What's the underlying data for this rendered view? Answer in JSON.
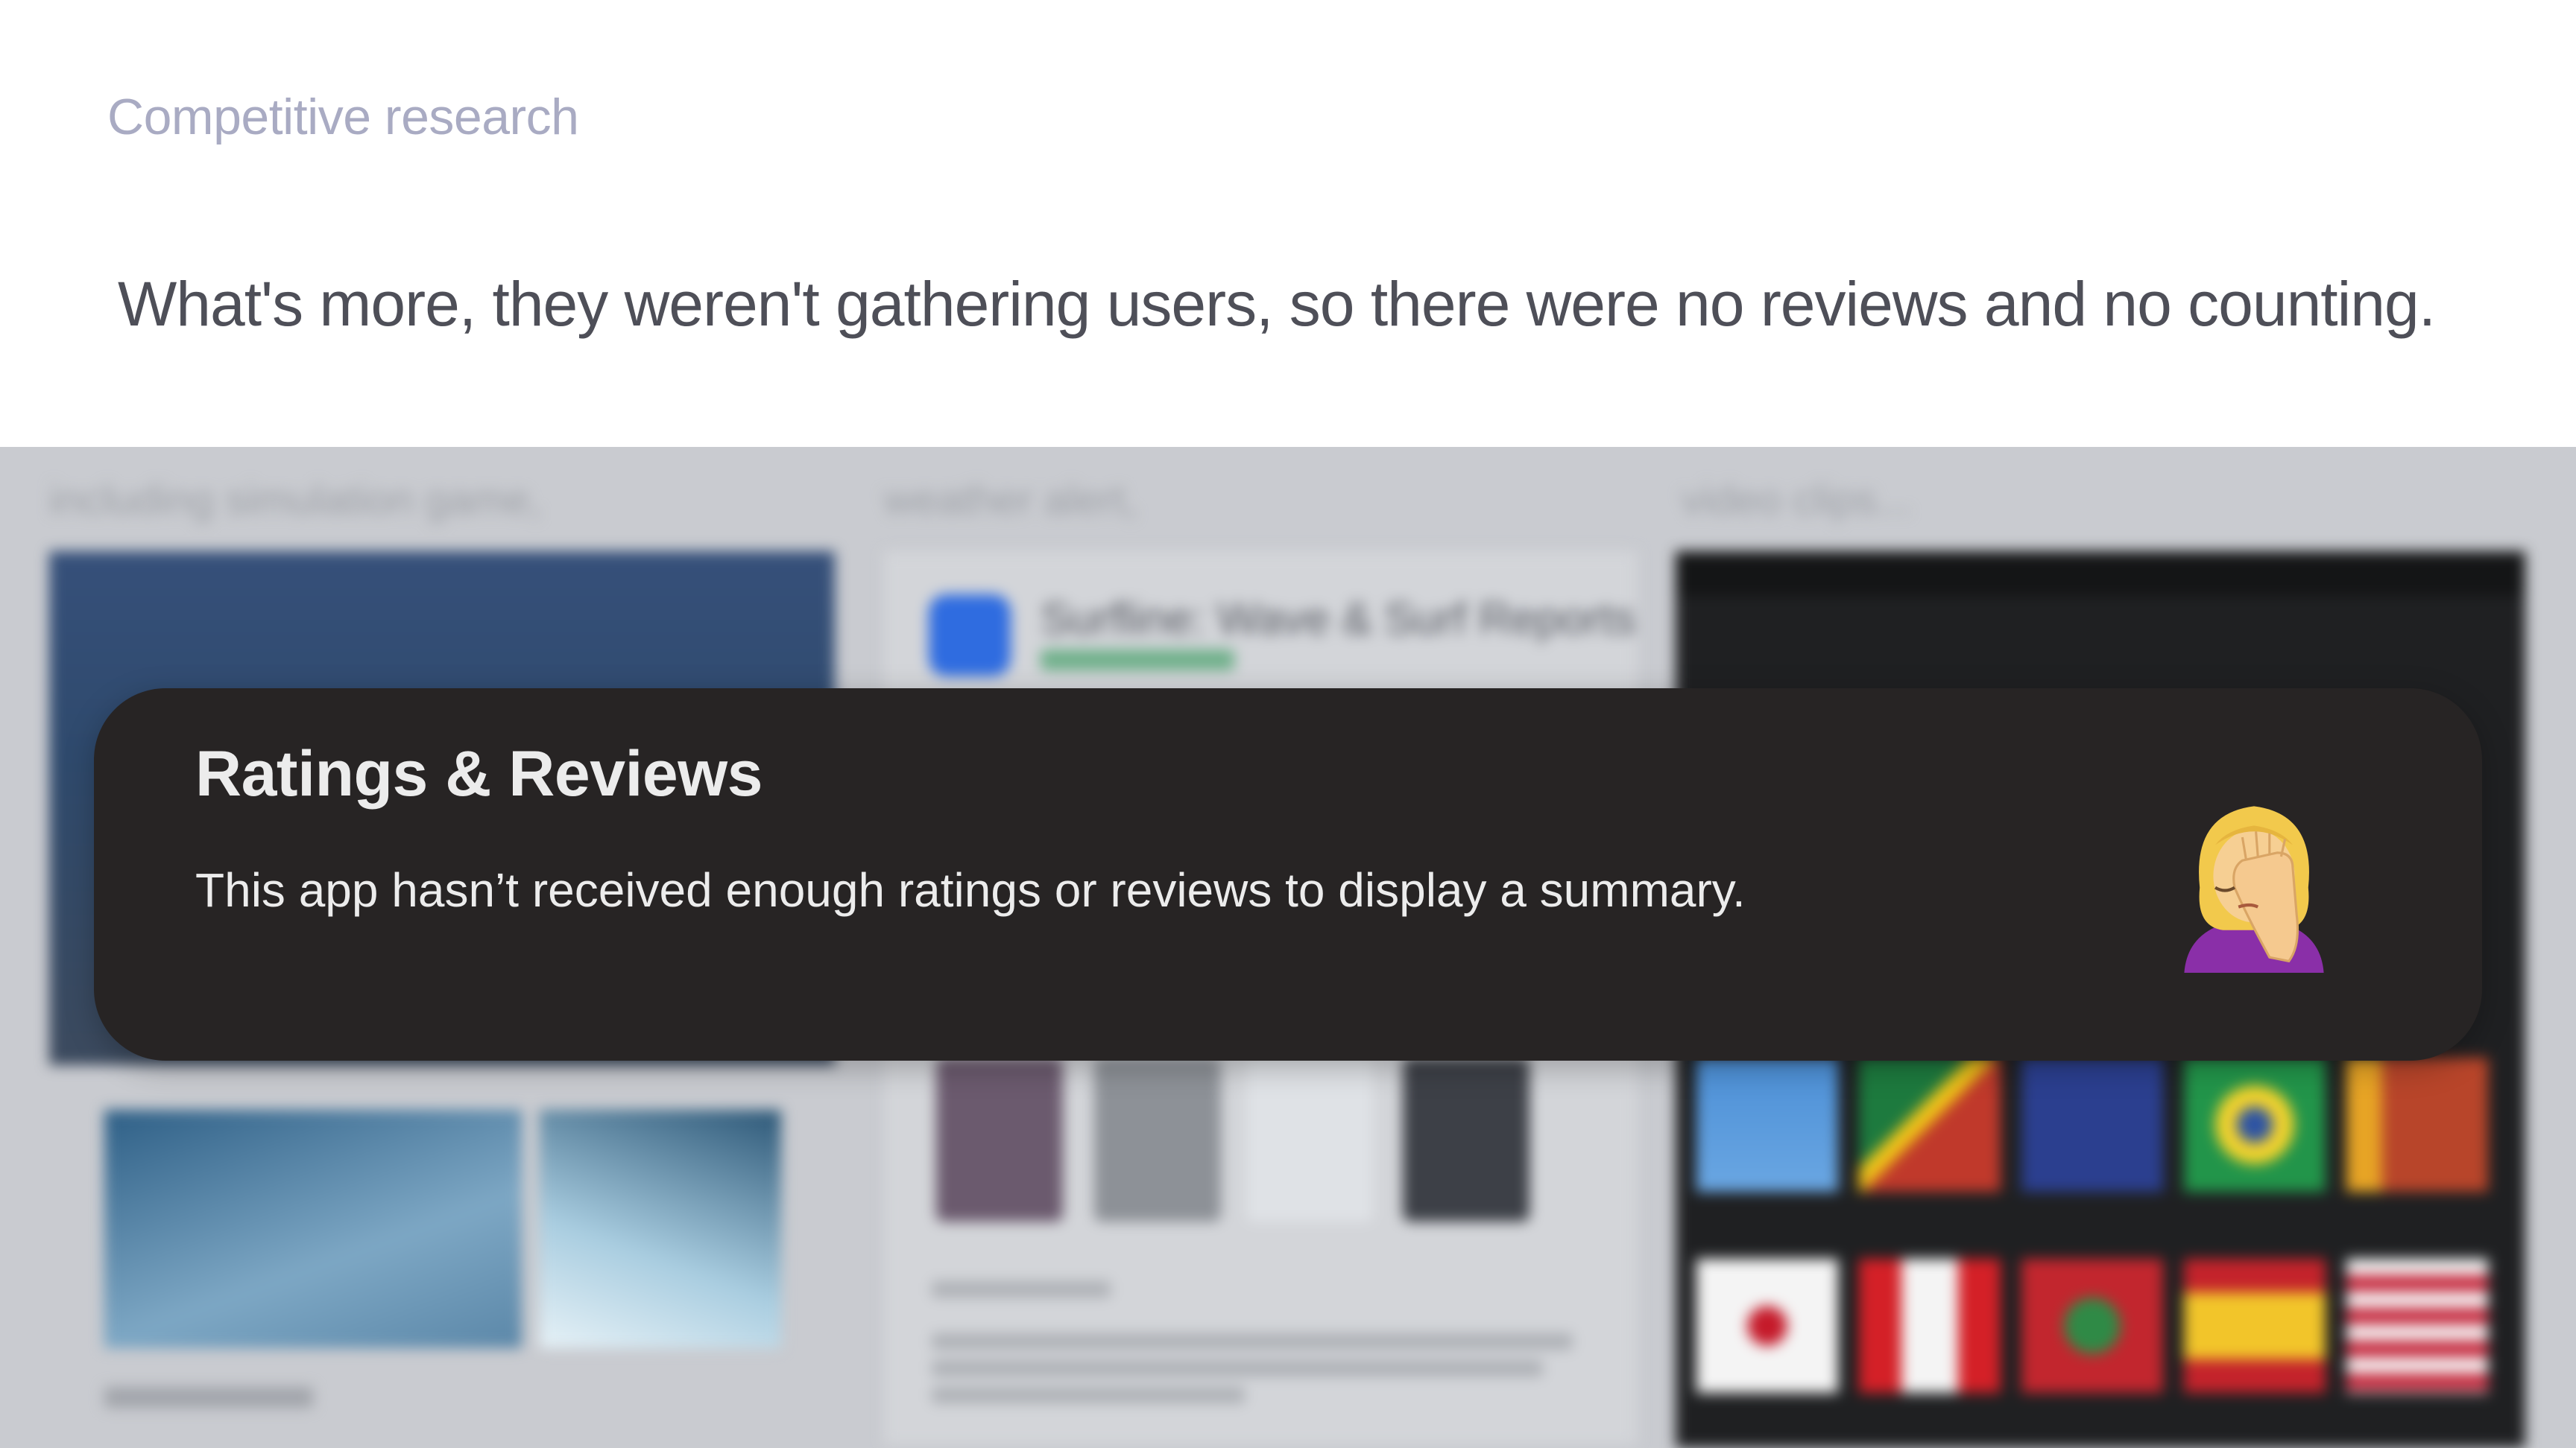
{
  "slide": {
    "eyebrow": "Competitive research",
    "headline": "What's more, they weren't gathering users, so there were no reviews and no counting."
  },
  "backdrop": {
    "captions": [
      "including simulation game,",
      "weather alert,",
      "video clips..."
    ],
    "weather_app_title": "Surfline: Wave & Surf Reports"
  },
  "ratings_card": {
    "title": "Ratings & Reviews",
    "message": "This app hasn’t received enough ratings or reviews to display a summary.",
    "emoji": "facepalm-woman-emoji"
  },
  "colors": {
    "eyebrow": "#a9abc3",
    "headline": "#4e4f58",
    "card_background": "#272424",
    "card_text": "#ececec",
    "backdrop": "#c9cbd0"
  }
}
